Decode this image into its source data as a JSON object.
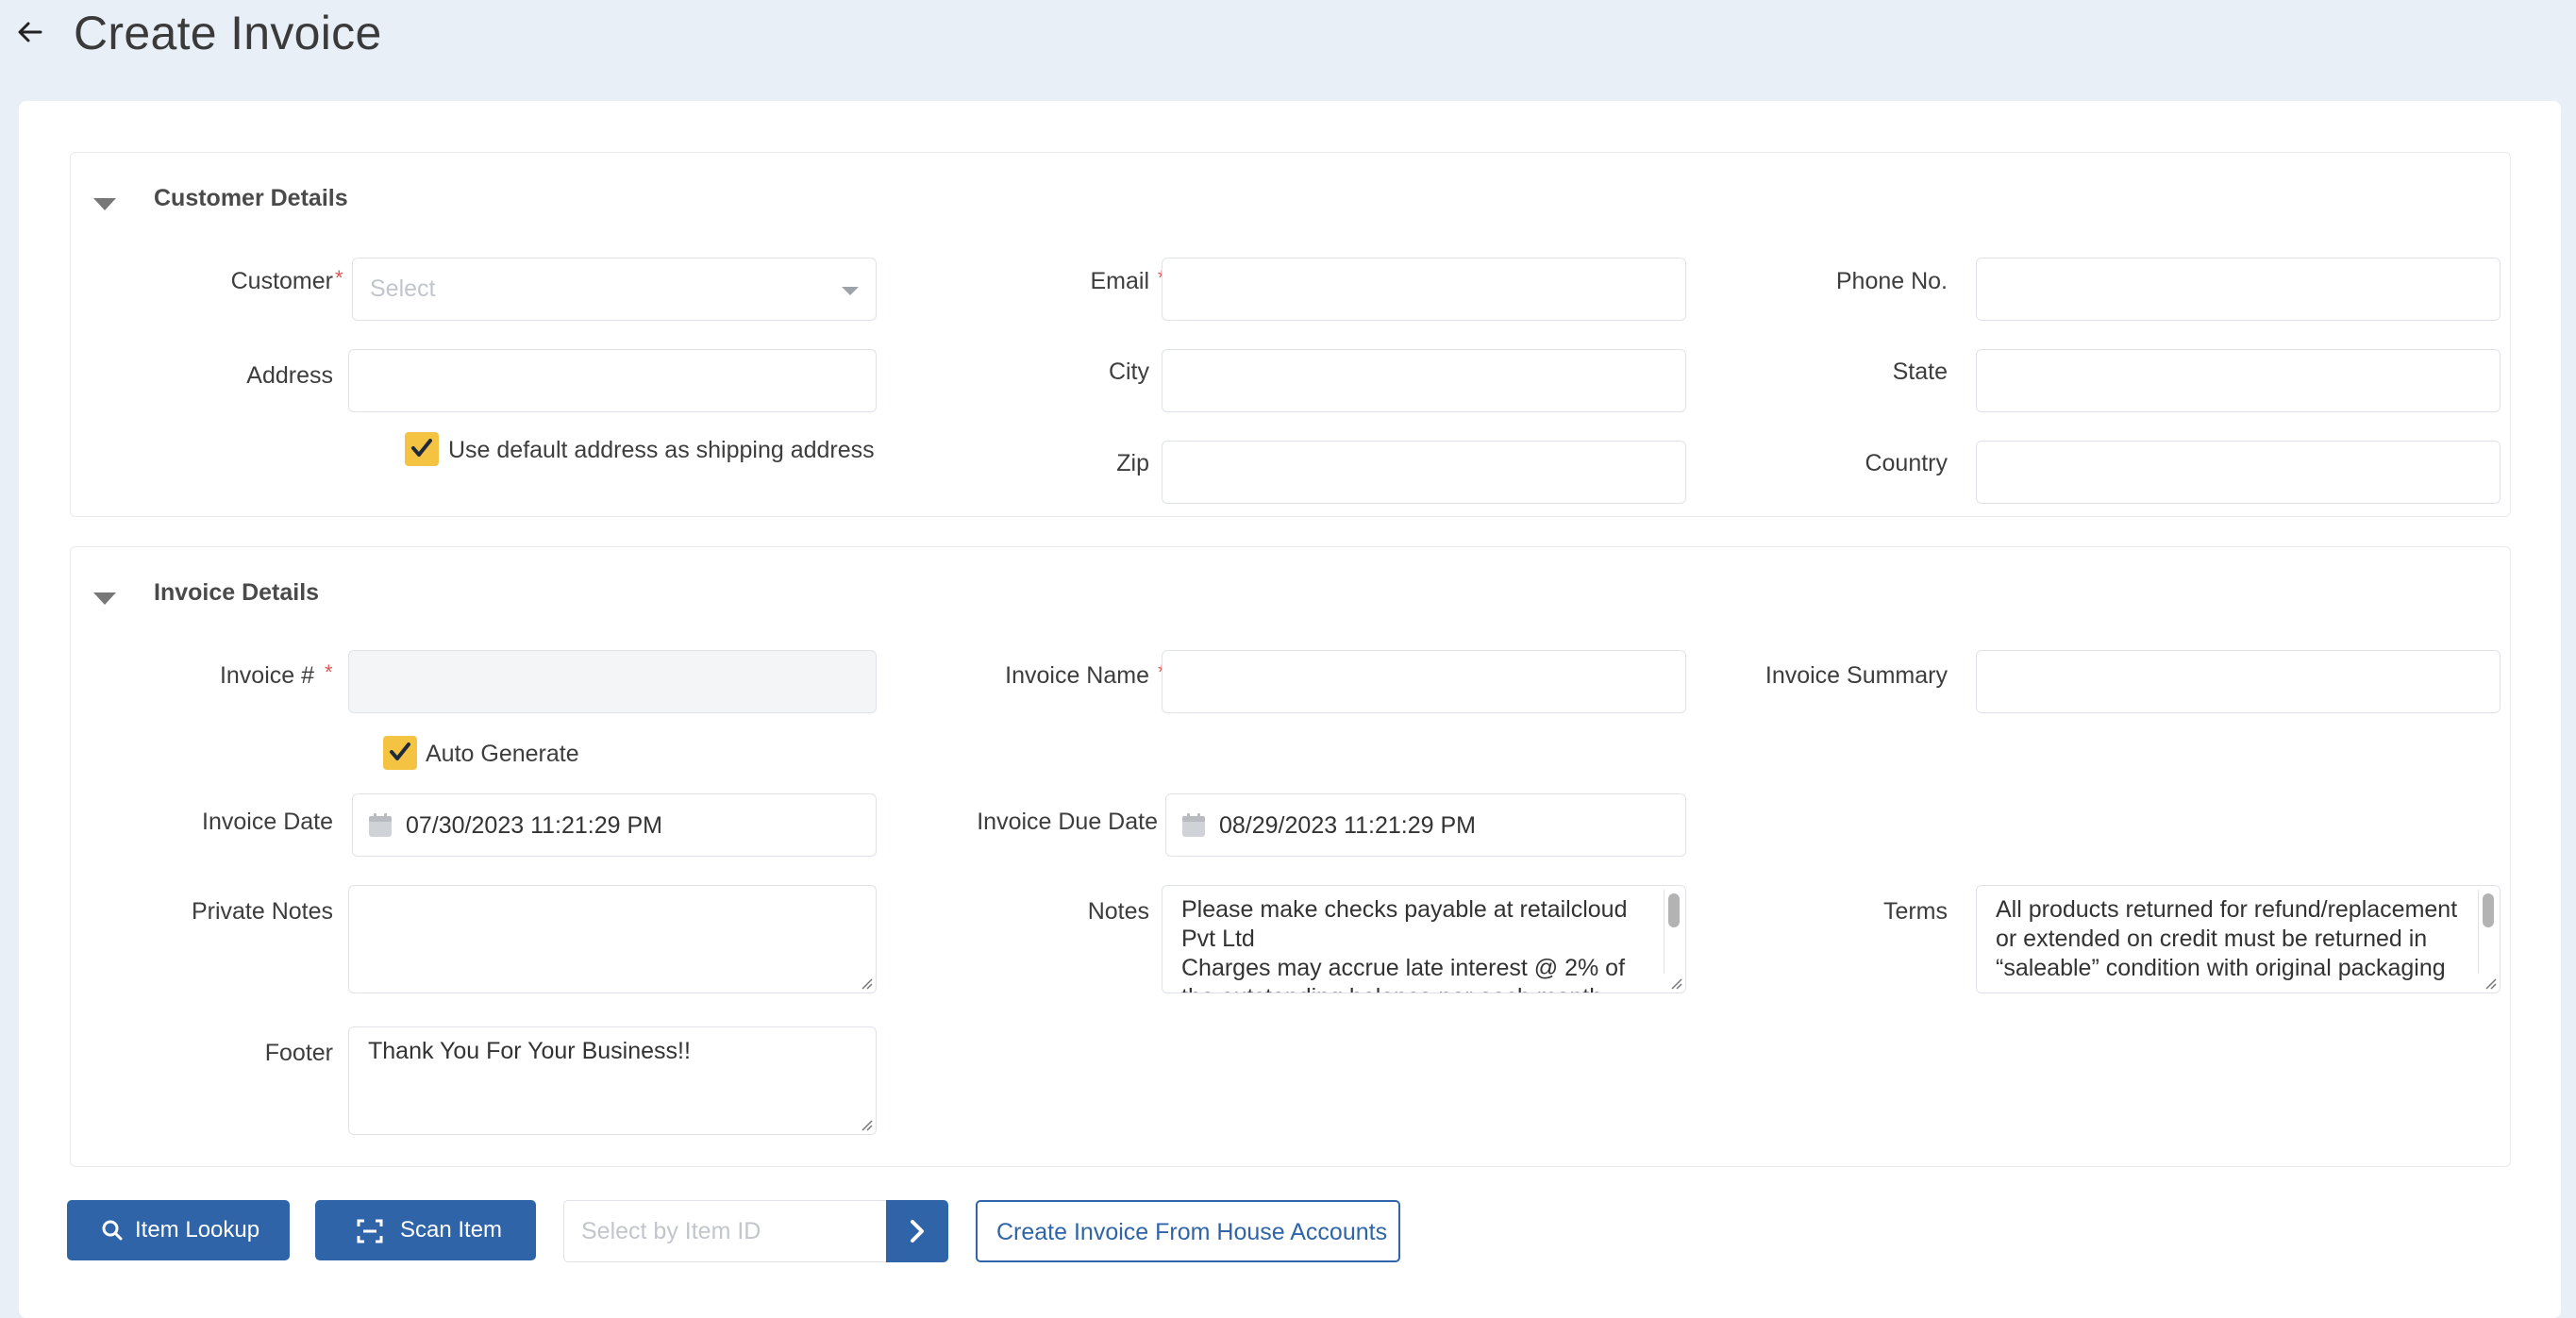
{
  "page": {
    "title": "Create Invoice"
  },
  "customer_details": {
    "title": "Customer Details",
    "customer_label": "Customer",
    "customer_placeholder": "Select",
    "email_label": "Email",
    "phone_label": "Phone No.",
    "address_label": "Address",
    "city_label": "City",
    "state_label": "State",
    "zip_label": "Zip",
    "country_label": "Country",
    "default_address_label": "Use default address as shipping address",
    "default_address_checked": true
  },
  "invoice_details": {
    "title": "Invoice Details",
    "invoice_no_label": "Invoice #",
    "invoice_name_label": "Invoice Name",
    "invoice_summary_label": "Invoice Summary",
    "auto_generate_label": "Auto Generate",
    "auto_generate_checked": true,
    "invoice_date_label": "Invoice Date",
    "invoice_date_value": "07/30/2023 11:21:29 PM",
    "due_date_label": "Invoice Due Date",
    "due_date_value": "08/29/2023 11:21:29 PM",
    "private_notes_label": "Private Notes",
    "notes_label": "Notes",
    "notes_value": "Please make checks payable at retailcloud Pvt Ltd\nCharges may accrue late interest @ 2% of the outstanding balance per each month",
    "terms_label": "Terms",
    "terms_value": "All products returned for refund/replacement or extended on credit must be returned in “saleable” condition with original packaging",
    "footer_label": "Footer",
    "footer_value": "Thank You For Your Business!!"
  },
  "actions": {
    "item_lookup_label": "Item Lookup",
    "scan_item_label": "Scan Item",
    "item_id_placeholder": "Select by Item ID",
    "house_accounts_label": "Create Invoice From House Accounts"
  },
  "colors": {
    "primary": "#2f65a8",
    "checkbox": "#f5c342",
    "required": "#e05454",
    "background": "#e9eff7"
  }
}
